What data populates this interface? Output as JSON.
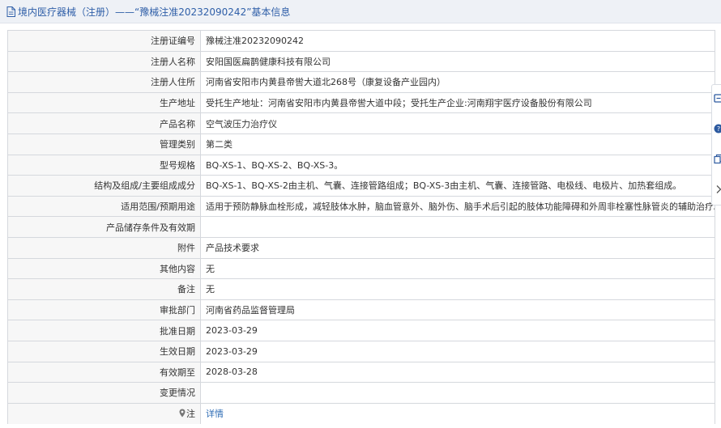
{
  "header": {
    "title": "境内医疗器械（注册）——“豫械注准20232090242”基本信息"
  },
  "rows": [
    {
      "label": "注册证编号",
      "value": "豫械注准20232090242"
    },
    {
      "label": "注册人名称",
      "value": "安阳国医扁鹊健康科技有限公司"
    },
    {
      "label": "注册人住所",
      "value": "河南省安阳市内黄县帝喾大道北268号（康复设备产业园内）"
    },
    {
      "label": "生产地址",
      "value": "受托生产地址：河南省安阳市内黄县帝喾大道中段；受托生产企业:河南翔宇医疗设备股份有限公司"
    },
    {
      "label": "产品名称",
      "value": "空气波压力治疗仪"
    },
    {
      "label": "管理类别",
      "value": "第二类"
    },
    {
      "label": "型号规格",
      "value": "BQ-XS-1、BQ-XS-2、BQ-XS-3。"
    },
    {
      "label": "结构及组成/主要组成成分",
      "value": "BQ-XS-1、BQ-XS-2由主机、气囊、连接管路组成；BQ-XS-3由主机、气囊、连接管路、电极线、电极片、加热套组成。"
    },
    {
      "label": "适用范围/预期用途",
      "value": "适用于预防静脉血栓形成，减轻肢体水肿，脑血管意外、脑外伤、脑手术后引起的肢体功能障碍和外周非栓塞性脉管炎的辅助治疗。"
    },
    {
      "label": "产品储存条件及有效期",
      "value": ""
    },
    {
      "label": "附件",
      "value": "产品技术要求"
    },
    {
      "label": "其他内容",
      "value": "无"
    },
    {
      "label": "备注",
      "value": "无"
    },
    {
      "label": "审批部门",
      "value": "河南省药品监督管理局"
    },
    {
      "label": "批准日期",
      "value": "2023-03-29"
    },
    {
      "label": "生效日期",
      "value": "2023-03-29"
    },
    {
      "label": "有效期至",
      "value": "2028-03-28"
    },
    {
      "label": "变更情况",
      "value": ""
    }
  ],
  "note": {
    "label": "注",
    "link": "详情"
  },
  "icons": {
    "header": "document-icon",
    "note": "map-pin-icon",
    "side_tools": [
      "feedback-icon",
      "help-icon",
      "copy-icon",
      "chevron-right-icon"
    ]
  },
  "colors": {
    "header_bg": "#eef1f6",
    "title": "#2f5fa8",
    "label_bg": "#f7f7f7",
    "border": "#d5d8dd",
    "link": "#2f6db5",
    "tool": "#2c5aa0"
  }
}
